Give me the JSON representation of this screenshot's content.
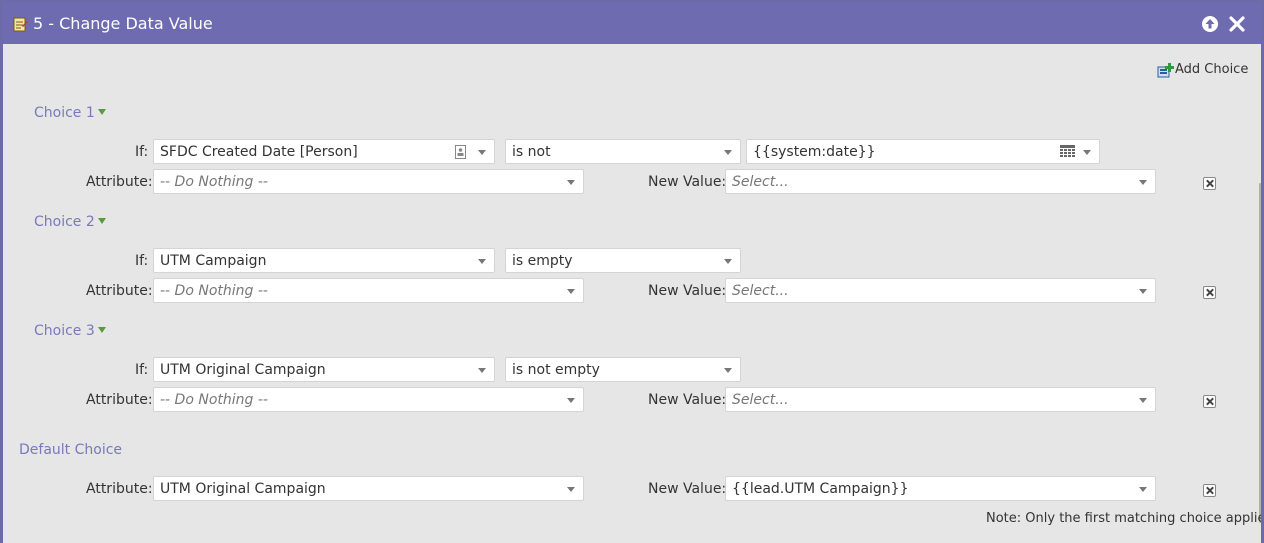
{
  "dialog": {
    "title": "5 - Change Data Value",
    "title_icon": "flow-step-icon",
    "controls": [
      "collapse-up-icon",
      "close-icon"
    ]
  },
  "add_choice_label": "Add Choice",
  "if_label": "If:",
  "attribute_label": "Attribute:",
  "new_value_label": "New Value:",
  "choices": [
    {
      "label": "Choice 1",
      "if_field": "SFDC Created Date [Person]",
      "operator": "is not",
      "if_value": "{{system:date}}",
      "attribute": "-- Do Nothing --",
      "new_value": "Select..."
    },
    {
      "label": "Choice 2",
      "if_field": "UTM Campaign",
      "operator": "is empty",
      "attribute": "-- Do Nothing --",
      "new_value": "Select..."
    },
    {
      "label": "Choice 3",
      "if_field": "UTM Original Campaign",
      "operator": "is not empty",
      "attribute": "-- Do Nothing --",
      "new_value": "Select..."
    }
  ],
  "default_choice": {
    "label": "Default Choice",
    "attribute": "UTM Original Campaign",
    "new_value": "{{lead.UTM Campaign}}"
  },
  "note": "Note: Only the first matching choice applies",
  "colors": {
    "titlebar": "#6e6bb0",
    "panel": "#e6e6e6",
    "choice_label": "#7a78bb",
    "triangle": "#5a9a3a"
  }
}
